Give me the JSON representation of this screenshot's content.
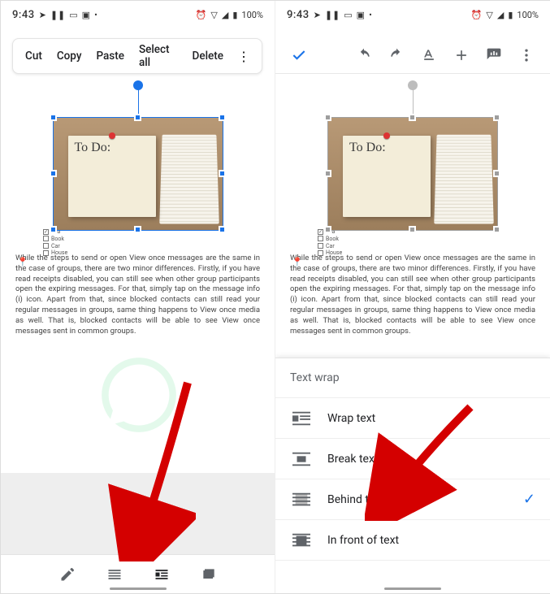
{
  "status": {
    "time": "9:43",
    "battery": "100%"
  },
  "context_menu": {
    "cut": "Cut",
    "copy": "Copy",
    "paste": "Paste",
    "select_all": "Select all",
    "delete": "Delete"
  },
  "image_note": {
    "text": "To Do:"
  },
  "checklist": {
    "items": {
      "0": "Tea",
      "1": "Book",
      "2": "Car",
      "3": "House"
    }
  },
  "paragraph": "While the steps to send or open View once messages are the same in the case of groups, there are two minor differences. Firstly, if you have read receipts disabled, you can still see when other group participants open the expiring messages. For that, simply tap on the message info (i) icon. Apart from that, since blocked contacts can still read your regular messages in groups, same thing happens to View once media as well. That is, blocked contacts will be able to see View once messages sent in common groups.",
  "sheet": {
    "title": "Text wrap",
    "wrap": "Wrap text",
    "break": "Break text",
    "behind": "Behind text",
    "front": "In front of text"
  }
}
